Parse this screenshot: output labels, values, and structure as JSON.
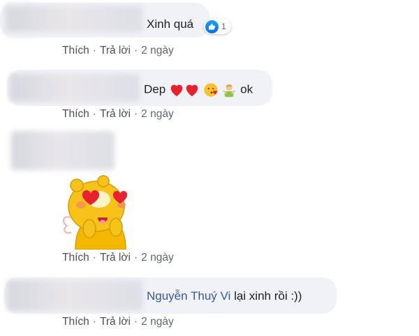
{
  "comments": [
    {
      "text": "Xinh quá",
      "reaction": {
        "icon": "like-icon",
        "count": "1",
        "color": "#1877f2"
      },
      "actions": {
        "like": "Thích",
        "reply": "Trả lời",
        "time": "2 ngày"
      }
    },
    {
      "text_prefix": "Dep",
      "emojis": [
        "red-heart-icon",
        "red-heart-icon",
        "face-blowing-kiss-icon",
        "person-gesturing-icon"
      ],
      "text_suffix": "ok",
      "actions": {
        "like": "Thích",
        "reply": "Trả lời",
        "time": "2 ngày"
      }
    },
    {
      "sticker": "yellow-bear-heart-eyes-sticker",
      "actions": {
        "like": "Thích",
        "reply": "Trả lời",
        "time": "2 ngày"
      }
    },
    {
      "mention": "Nguyễn Thuý Vi",
      "text": " lại xinh rồi :))",
      "actions": {
        "like": "Thích",
        "reply": "Trả lời",
        "time": "2 ngày"
      }
    }
  ],
  "separator": "·",
  "colors": {
    "bubble": "#f0f2f5",
    "meta": "#606770",
    "link": "#385898"
  }
}
